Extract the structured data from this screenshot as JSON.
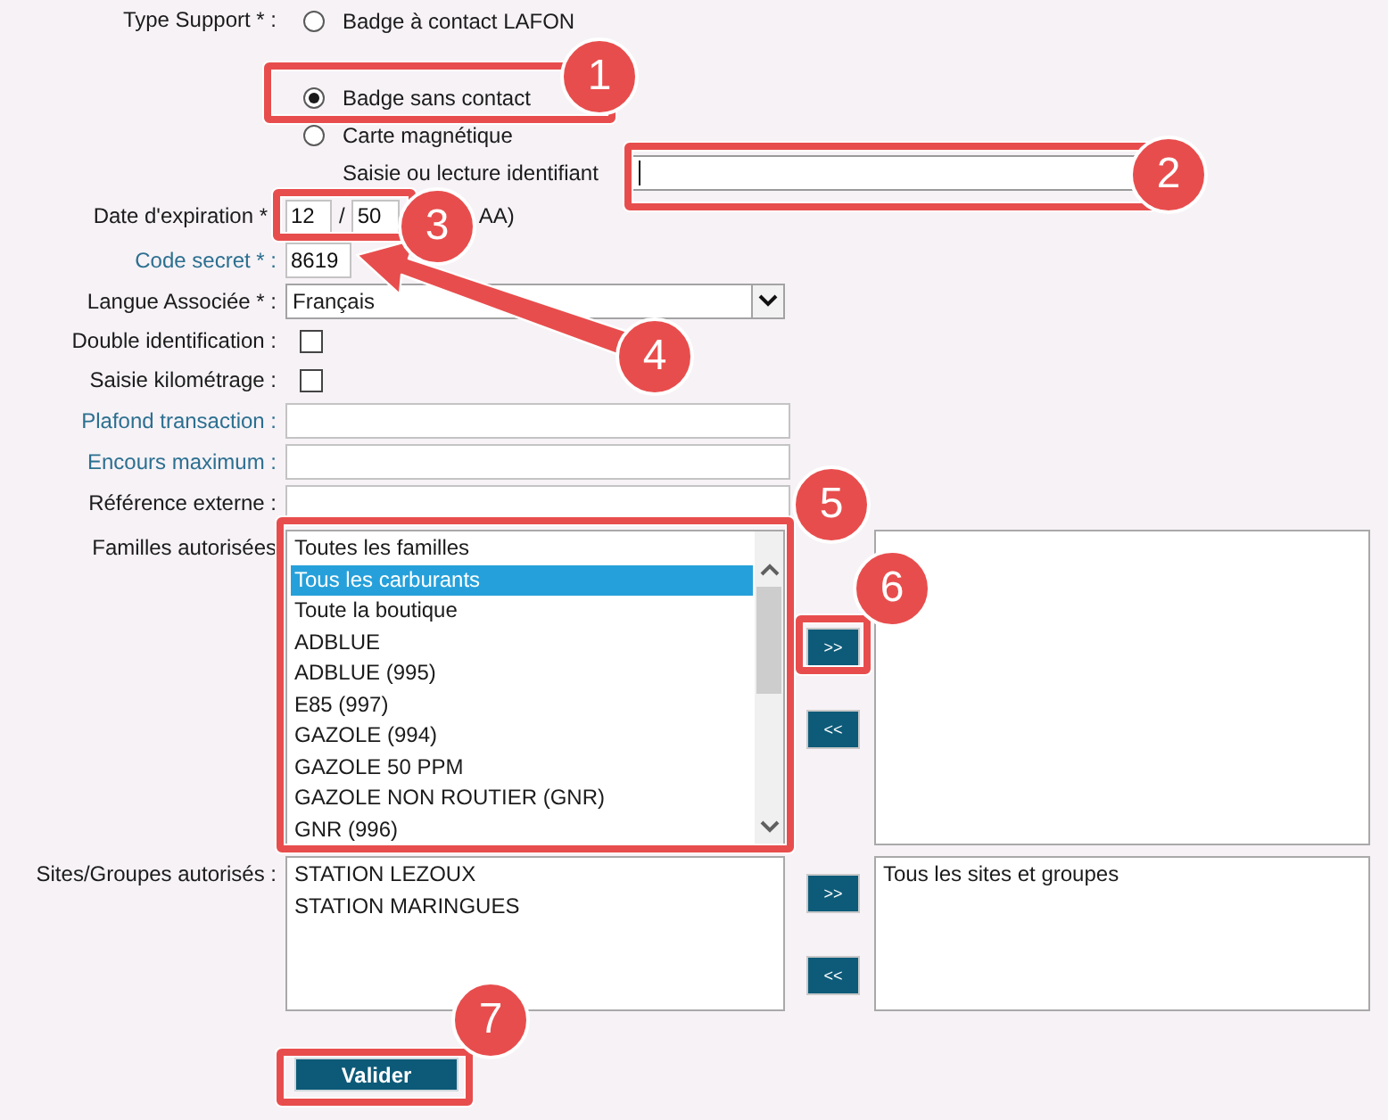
{
  "form": {
    "fields": [
      {
        "kind": "radio_group",
        "label": "Type Support * :",
        "label_link": false,
        "options": [
          {
            "label": "Badge à contact LAFON",
            "selected": false
          },
          {
            "label": "Badge sans contact",
            "selected": true
          },
          {
            "label": "Carte magnétique",
            "selected": false
          }
        ],
        "id_entry": {
          "label": "Saisie ou lecture identifiant",
          "focused": true
        }
      },
      {
        "kind": "date",
        "label": "Date d'expiration *",
        "label_link": false,
        "month": "12",
        "separator": "/",
        "year": "50",
        "hint": "AA)"
      },
      {
        "kind": "code",
        "label": "Code secret * :",
        "label_link": true,
        "value": "8619"
      },
      {
        "kind": "select",
        "label": "Langue Associée * :",
        "label_link": false,
        "value": "Français"
      },
      {
        "kind": "checkbox",
        "label": "Double identification :",
        "label_link": false,
        "checked": false
      },
      {
        "kind": "checkbox",
        "label": "Saisie kilométrage :",
        "label_link": false,
        "checked": false
      },
      {
        "kind": "text",
        "label": "Plafond transaction :",
        "label_link": true
      },
      {
        "kind": "text",
        "label": "Encours maximum :",
        "label_link": true
      },
      {
        "kind": "text",
        "label": "Référence externe :",
        "label_link": false
      },
      {
        "kind": "transfer",
        "label": "Familles autorisées",
        "label_link": false,
        "scrollable": true,
        "available": [
          {
            "label": "Toutes les familles",
            "selected": false
          },
          {
            "label": "Tous les carburants",
            "selected": true
          },
          {
            "label": "Toute la boutique",
            "selected": false
          },
          {
            "label": "ADBLUE",
            "selected": false
          },
          {
            "label": "ADBLUE (995)",
            "selected": false
          },
          {
            "label": "E85 (997)",
            "selected": false
          },
          {
            "label": "GAZOLE (994)",
            "selected": false
          },
          {
            "label": "GAZOLE 50 PPM",
            "selected": false
          },
          {
            "label": "GAZOLE NON ROUTIER (GNR)",
            "selected": false
          },
          {
            "label": "GNR (996)",
            "selected": false
          }
        ],
        "add_button": ">>",
        "remove_button": "<<"
      },
      {
        "kind": "transfer",
        "label": "Sites/Groupes autorisés :",
        "label_link": false,
        "available": [
          {
            "label": "STATION LEZOUX",
            "selected": false
          },
          {
            "label": "STATION MARINGUES",
            "selected": false
          }
        ],
        "add_button": ">>",
        "remove_button": "<<",
        "chosen": [
          {
            "label": "Tous les sites et groupes",
            "selected": false
          }
        ]
      }
    ]
  },
  "submit_button": "Valider",
  "annotations": [
    {
      "kind": "frame",
      "number": "1"
    },
    {
      "kind": "frame",
      "number": "2"
    },
    {
      "kind": "frame",
      "number": "3"
    },
    {
      "kind": "arrow",
      "number": "4"
    },
    {
      "kind": "frame",
      "number": "5"
    },
    {
      "kind": "frame",
      "number": "6"
    },
    {
      "kind": "frame",
      "number": "7"
    }
  ]
}
